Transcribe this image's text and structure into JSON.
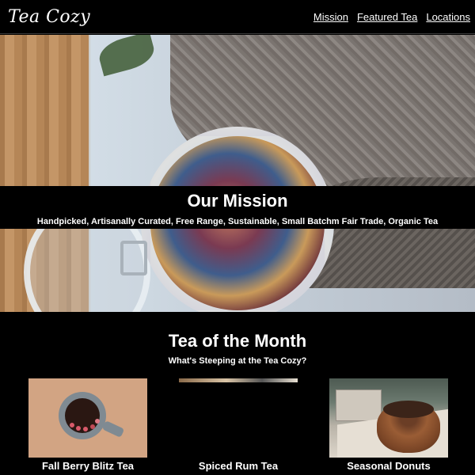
{
  "header": {
    "logo": "Tea Cozy",
    "nav": [
      "Mission",
      "Featured Tea",
      "Locations"
    ]
  },
  "hero": {
    "title": "Our Mission",
    "subtitle": "Handpicked, Artisanally Curated, Free Range, Sustainable, Small Batchm Fair Trade, Organic Tea"
  },
  "month": {
    "title": "Tea of the Month",
    "subtitle": "What's Steeping at the Tea Cozy?",
    "items": [
      {
        "name": "Fall Berry Blitz Tea"
      },
      {
        "name": "Spiced Rum Tea"
      },
      {
        "name": "Seasonal Donuts"
      }
    ]
  }
}
